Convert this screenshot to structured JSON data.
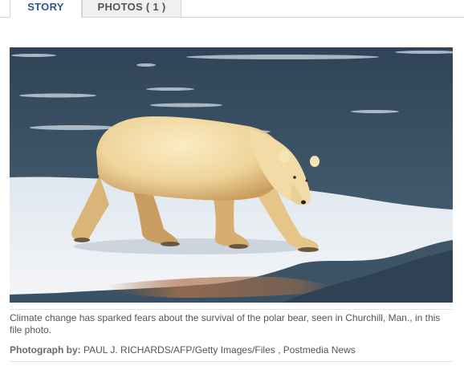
{
  "tabs": {
    "story_label": "STORY",
    "photos_label": "PHOTOS ( 1 )"
  },
  "photo": {
    "subject": "polar bear",
    "colors": {
      "water": "#3d5568",
      "ice": "#e6ecf2",
      "fur": "#f0d9a4",
      "fur_shadow": "#c9a26a"
    }
  },
  "caption": {
    "text": "Climate change has sparked fears about the survival of the polar bear, seen in Churchill, Man., in this file photo.",
    "credit_label": "Photograph by:",
    "credit_value": "PAUL J. RICHARDS/AFP/Getty Images/Files , Postmedia News"
  }
}
